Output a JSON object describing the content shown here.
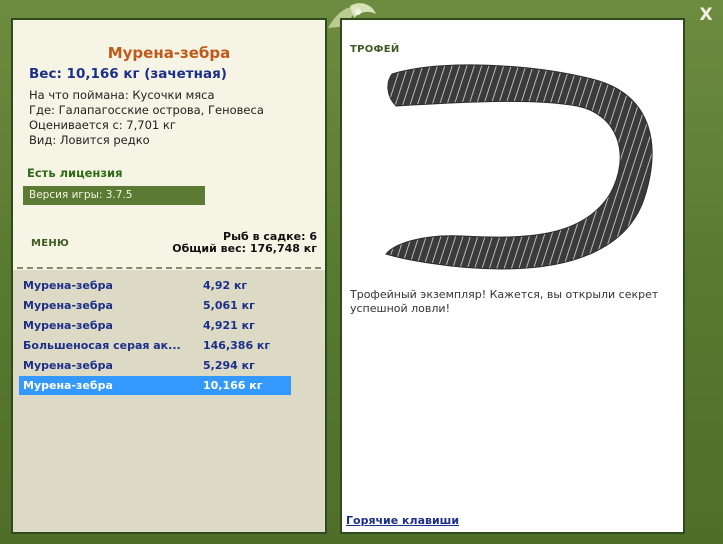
{
  "window": {
    "close_label": "X"
  },
  "left": {
    "fish_name": "Мурена-зебра",
    "weight_line": "Вес: 10,166 кг (зачетная)",
    "bait_line": "На что поймана: Кусочки мяса",
    "location_line": "Где: Галапагосские острова, Геновеса",
    "value_line": "Оценивается с: 7,701 кг",
    "kind_line": "Вид: Ловится редко",
    "license": "Есть лицензия",
    "version": "Версия игры: 3.7.5",
    "menu": "МЕНЮ",
    "keep_count": "Рыб в садке: 6",
    "keep_weight": "Общий вес: 176,748 кг",
    "catches": [
      {
        "name": "Мурена-зебра",
        "weight": "4,92 кг"
      },
      {
        "name": "Мурена-зебра",
        "weight": "5,061 кг"
      },
      {
        "name": "Мурена-зебра",
        "weight": "4,921 кг"
      },
      {
        "name": "Большеносая серая ак...",
        "weight": "146,386 кг"
      },
      {
        "name": "Мурена-зебра",
        "weight": "5,294 кг"
      },
      {
        "name": "Мурена-зебра",
        "weight": "10,166 кг"
      }
    ],
    "selected_index": 5
  },
  "right": {
    "trophy_label": "ТРОФЕЙ",
    "description": "Трофейный экземпляр! Кажется, вы открыли секрет успешной ловли!",
    "hotkeys": "Горячие клавиши"
  },
  "colors": {
    "frame": "#5b7a33",
    "panel": "#f6f4e4",
    "title": "#c05a1a",
    "link": "#1c2f8a",
    "selection": "#3399ff"
  }
}
